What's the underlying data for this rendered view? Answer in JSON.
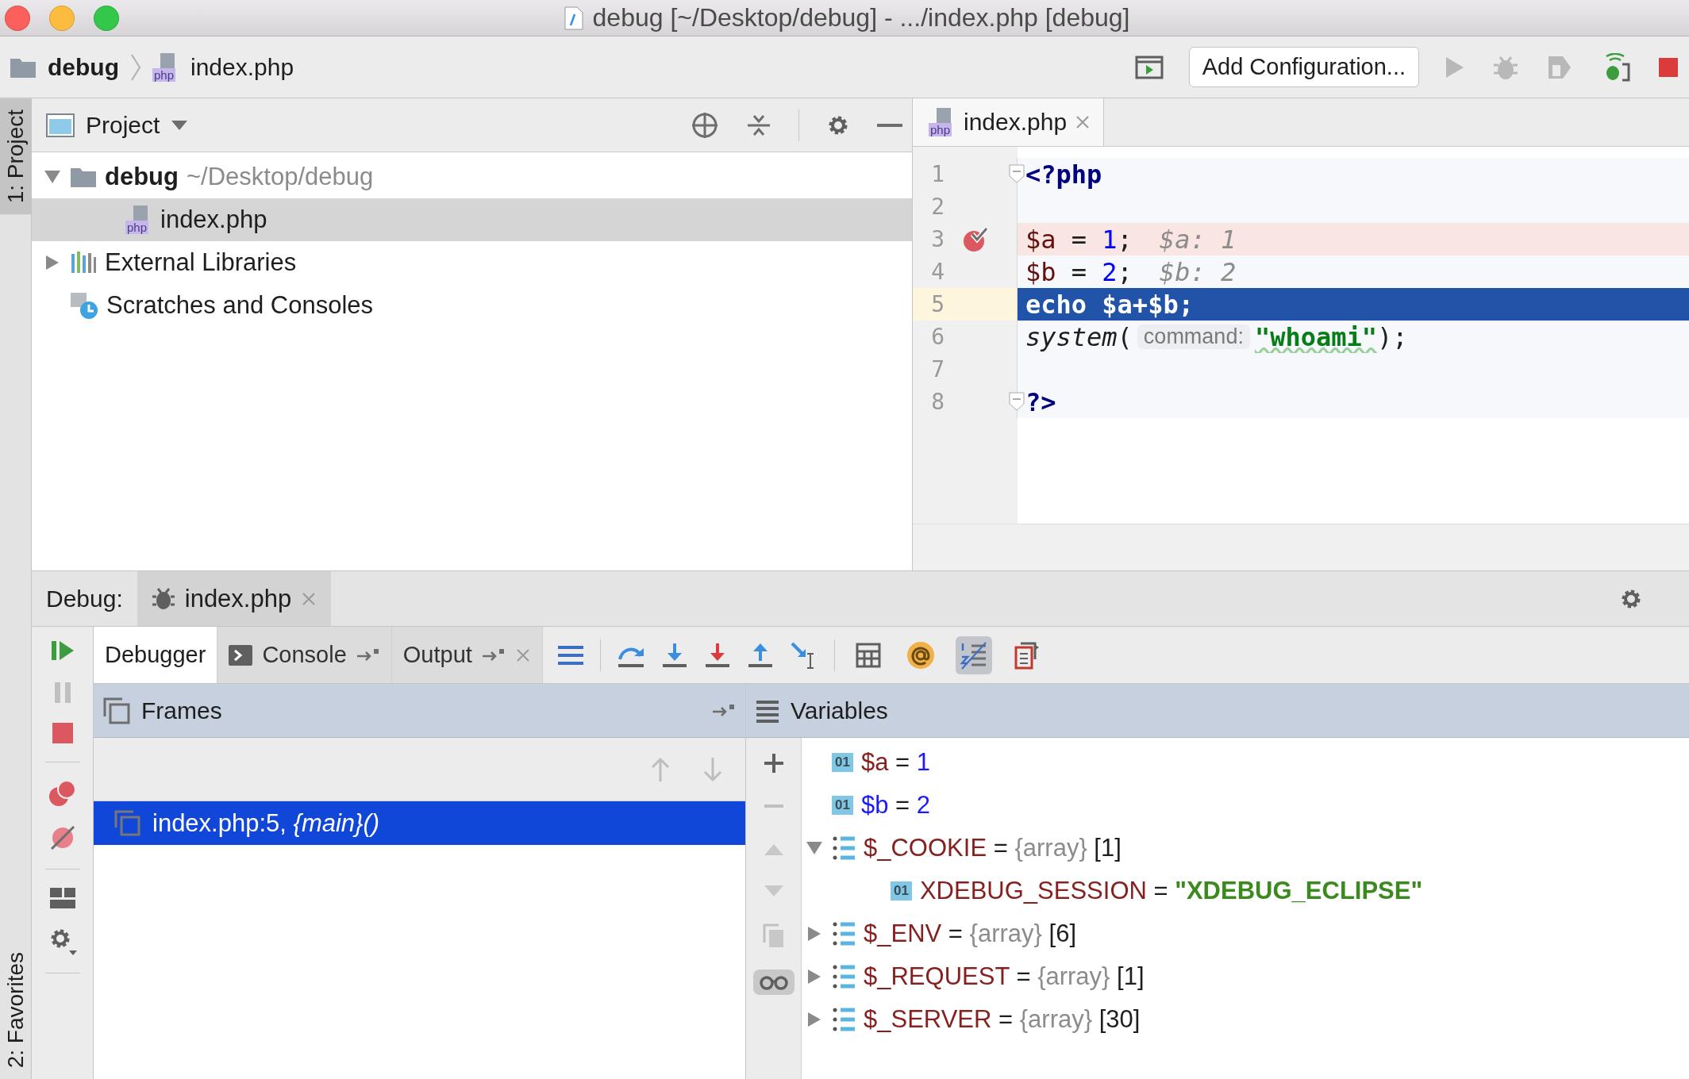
{
  "window": {
    "title": "debug [~/Desktop/debug] - .../index.php [debug]"
  },
  "navbar": {
    "breadcrumbs": [
      {
        "label": "debug",
        "kind": "folder"
      },
      {
        "label": "index.php",
        "kind": "php",
        "badge": "php"
      }
    ],
    "run_config": "Add Configuration..."
  },
  "side_tabs": [
    {
      "label": "1: Project",
      "selected": true
    },
    {
      "label": "2: Favorites",
      "selected": false
    }
  ],
  "project": {
    "title": "Project",
    "tree": [
      {
        "label": "debug",
        "path": "~/Desktop/debug",
        "kind": "folder",
        "selected": false,
        "expanded": true,
        "children": [
          {
            "label": "index.php",
            "kind": "php",
            "badge": "php",
            "selected": true
          }
        ]
      },
      {
        "label": "External Libraries",
        "kind": "library",
        "selected": false,
        "expanded": false
      },
      {
        "label": "Scratches and Consoles",
        "kind": "scratch",
        "selected": false
      }
    ]
  },
  "editor": {
    "tabs": [
      {
        "label": "index.php",
        "badge": "php",
        "selected": true
      }
    ],
    "lines": [
      {
        "number": "1",
        "breakpoint": false,
        "current": false,
        "fold": true,
        "tokens": [
          {
            "kind": "tag",
            "text": "<?php"
          }
        ]
      },
      {
        "number": "2",
        "breakpoint": false,
        "current": false,
        "fold": false
      },
      {
        "number": "3",
        "breakpoint": true,
        "current": false,
        "fold": false,
        "tokens": [
          {
            "kind": "var",
            "text": "$a"
          },
          {
            "kind": "plain",
            "text": " = "
          },
          {
            "kind": "num",
            "text": "1"
          },
          {
            "kind": "plain",
            "text": ";"
          },
          {
            "kind": "value",
            "text": "$a: 1"
          }
        ]
      },
      {
        "number": "4",
        "breakpoint": false,
        "current": false,
        "fold": false,
        "tokens": [
          {
            "kind": "var",
            "text": "$b"
          },
          {
            "kind": "plain",
            "text": " = "
          },
          {
            "kind": "num",
            "text": "2"
          },
          {
            "kind": "plain",
            "text": ";"
          },
          {
            "kind": "value",
            "text": "$b: 2"
          }
        ]
      },
      {
        "number": "5",
        "breakpoint": false,
        "current": true,
        "fold": false,
        "tokens": [
          {
            "kind": "keyword",
            "text": "echo "
          },
          {
            "kind": "var",
            "text": "$a"
          },
          {
            "kind": "plain",
            "text": "+"
          },
          {
            "kind": "var",
            "text": "$b"
          },
          {
            "kind": "plain",
            "text": ";"
          }
        ]
      },
      {
        "number": "6",
        "breakpoint": false,
        "current": false,
        "fold": false,
        "tokens": [
          {
            "kind": "func",
            "text": "system"
          },
          {
            "kind": "plain",
            "text": "("
          },
          {
            "kind": "hint",
            "text": "command:"
          },
          {
            "kind": "str",
            "text": "\"whoami\""
          },
          {
            "kind": "plain",
            "text": ");"
          }
        ]
      },
      {
        "number": "7",
        "breakpoint": false,
        "current": false,
        "fold": false
      },
      {
        "number": "8",
        "breakpoint": false,
        "current": false,
        "fold": true,
        "tokens": [
          {
            "kind": "tag",
            "text": "?>"
          }
        ]
      }
    ]
  },
  "debug": {
    "label": "Debug:",
    "sessions": [
      {
        "label": "index.php",
        "selected": true
      }
    ],
    "tabs": [
      {
        "label": "Debugger",
        "kind": "debugger",
        "selected": true
      },
      {
        "label": "Console",
        "kind": "console",
        "selected": false
      },
      {
        "label": "Output",
        "kind": "output",
        "selected": false
      }
    ],
    "toggles": [
      {
        "kind": "evaluate",
        "on": false
      },
      {
        "kind": "watch",
        "on": false
      },
      {
        "kind": "line-numbers",
        "on": true
      },
      {
        "kind": "restore",
        "on": false
      }
    ],
    "frames": {
      "title": "Frames",
      "items": [
        {
          "location": "index.php:5, ",
          "function": "{main}()",
          "selected": true
        }
      ]
    },
    "variables": {
      "title": "Variables",
      "show_watches": true,
      "items": [
        {
          "name": "$a",
          "op": " = ",
          "kind": "number",
          "badge": "01",
          "value": "1",
          "changed": false
        },
        {
          "name": "$b",
          "op": " = ",
          "kind": "number",
          "badge": "01",
          "value": "2",
          "changed": true
        },
        {
          "name": "$_COOKIE",
          "op": " = ",
          "kind": "array",
          "type": "{array}",
          "count": " [1]",
          "changed": false,
          "expanded": true,
          "children": [
            {
              "name": "XDEBUG_SESSION",
              "op": " = ",
              "kind": "string",
              "badge": "01",
              "value": "\"XDEBUG_ECLIPSE\"",
              "changed": false
            }
          ]
        },
        {
          "name": "$_ENV",
          "op": " = ",
          "kind": "array",
          "type": "{array}",
          "count": " [6]",
          "changed": false,
          "expanded": false
        },
        {
          "name": "$_REQUEST",
          "op": " = ",
          "kind": "array",
          "type": "{array}",
          "count": " [1]",
          "changed": false,
          "expanded": false
        },
        {
          "name": "$_SERVER",
          "op": " = ",
          "kind": "array",
          "type": "{array}",
          "count": " [30]",
          "changed": false,
          "expanded": false
        }
      ]
    }
  }
}
